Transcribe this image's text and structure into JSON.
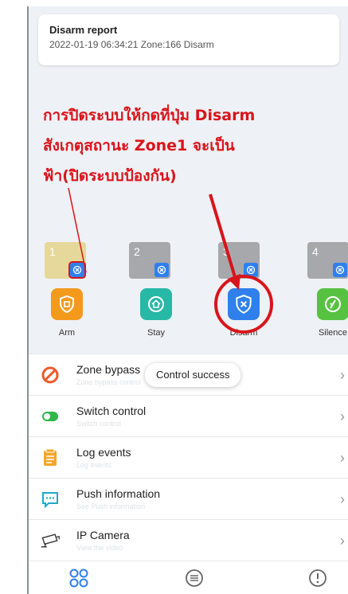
{
  "report": {
    "title": "Disarm report",
    "detail": "2022-01-19 06:34:21 Zone:166 Disarm"
  },
  "annotation": {
    "line1": "การปิดระบบให้กดที่ปุ่ม Disarm",
    "line2": "สังเกตุสถานะ Zone1 จะเป็น",
    "line3": "ฟ้า(ปิดระบบป้องกัน)"
  },
  "zones": [
    {
      "number": "1",
      "state_color": "#e6d89a"
    },
    {
      "number": "2",
      "state_color": "#a6a8ab"
    },
    {
      "number": "3",
      "state_color": "#a6a8ab"
    },
    {
      "number": "4",
      "state_color": "#a6a8ab"
    }
  ],
  "actions": [
    {
      "label": "Arm",
      "color": "#f39a1d",
      "icon": "arm-shield-icon"
    },
    {
      "label": "Stay",
      "color": "#28b8a6",
      "icon": "stay-house-icon"
    },
    {
      "label": "Disarm",
      "color": "#2f80ed",
      "icon": "disarm-shield-icon"
    },
    {
      "label": "Silence",
      "color": "#57c242",
      "icon": "silence-icon"
    }
  ],
  "menu": [
    {
      "title": "Zone bypass",
      "subtitle": "Zone bypass control",
      "icon": "bypass-icon"
    },
    {
      "title": "Switch control",
      "subtitle": "Switch control",
      "icon": "toggle-icon"
    },
    {
      "title": "Log events",
      "subtitle": "Log events",
      "icon": "log-icon"
    },
    {
      "title": "Push information",
      "subtitle": "See Push information",
      "icon": "message-icon"
    },
    {
      "title": "IP Camera",
      "subtitle": "View the video",
      "icon": "camera-icon"
    }
  ],
  "toast": "Control success",
  "tabs": [
    {
      "icon": "home-grid-icon"
    },
    {
      "icon": "list-icon"
    },
    {
      "icon": "info-icon"
    }
  ],
  "colors": {
    "accent_blue": "#2f80ed",
    "annotation_red": "#d9141b"
  }
}
